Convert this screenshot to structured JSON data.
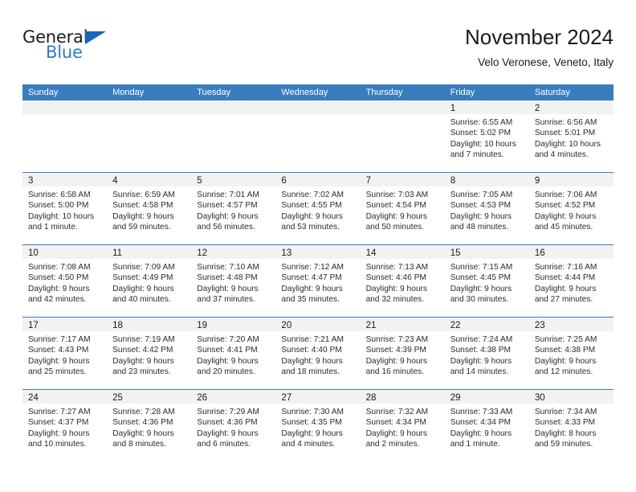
{
  "brand": {
    "name_part1": "General",
    "name_part2": "Blue",
    "flag_icon": "triangle-flag-icon",
    "accent_color": "#1268b3"
  },
  "header": {
    "title": "November 2024",
    "subtitle": "Velo Veronese, Veneto, Italy"
  },
  "calendar": {
    "header_color": "#3a7dbf",
    "band_color": "#f2f2f2",
    "weekdays": [
      "Sunday",
      "Monday",
      "Tuesday",
      "Wednesday",
      "Thursday",
      "Friday",
      "Saturday"
    ],
    "weeks": [
      [
        {
          "day": "",
          "empty": true
        },
        {
          "day": "",
          "empty": true
        },
        {
          "day": "",
          "empty": true
        },
        {
          "day": "",
          "empty": true
        },
        {
          "day": "",
          "empty": true
        },
        {
          "day": "1",
          "sunrise": "Sunrise: 6:55 AM",
          "sunset": "Sunset: 5:02 PM",
          "daylight1": "Daylight: 10 hours",
          "daylight2": "and 7 minutes."
        },
        {
          "day": "2",
          "sunrise": "Sunrise: 6:56 AM",
          "sunset": "Sunset: 5:01 PM",
          "daylight1": "Daylight: 10 hours",
          "daylight2": "and 4 minutes."
        }
      ],
      [
        {
          "day": "3",
          "sunrise": "Sunrise: 6:58 AM",
          "sunset": "Sunset: 5:00 PM",
          "daylight1": "Daylight: 10 hours",
          "daylight2": "and 1 minute."
        },
        {
          "day": "4",
          "sunrise": "Sunrise: 6:59 AM",
          "sunset": "Sunset: 4:58 PM",
          "daylight1": "Daylight: 9 hours",
          "daylight2": "and 59 minutes."
        },
        {
          "day": "5",
          "sunrise": "Sunrise: 7:01 AM",
          "sunset": "Sunset: 4:57 PM",
          "daylight1": "Daylight: 9 hours",
          "daylight2": "and 56 minutes."
        },
        {
          "day": "6",
          "sunrise": "Sunrise: 7:02 AM",
          "sunset": "Sunset: 4:55 PM",
          "daylight1": "Daylight: 9 hours",
          "daylight2": "and 53 minutes."
        },
        {
          "day": "7",
          "sunrise": "Sunrise: 7:03 AM",
          "sunset": "Sunset: 4:54 PM",
          "daylight1": "Daylight: 9 hours",
          "daylight2": "and 50 minutes."
        },
        {
          "day": "8",
          "sunrise": "Sunrise: 7:05 AM",
          "sunset": "Sunset: 4:53 PM",
          "daylight1": "Daylight: 9 hours",
          "daylight2": "and 48 minutes."
        },
        {
          "day": "9",
          "sunrise": "Sunrise: 7:06 AM",
          "sunset": "Sunset: 4:52 PM",
          "daylight1": "Daylight: 9 hours",
          "daylight2": "and 45 minutes."
        }
      ],
      [
        {
          "day": "10",
          "sunrise": "Sunrise: 7:08 AM",
          "sunset": "Sunset: 4:50 PM",
          "daylight1": "Daylight: 9 hours",
          "daylight2": "and 42 minutes."
        },
        {
          "day": "11",
          "sunrise": "Sunrise: 7:09 AM",
          "sunset": "Sunset: 4:49 PM",
          "daylight1": "Daylight: 9 hours",
          "daylight2": "and 40 minutes."
        },
        {
          "day": "12",
          "sunrise": "Sunrise: 7:10 AM",
          "sunset": "Sunset: 4:48 PM",
          "daylight1": "Daylight: 9 hours",
          "daylight2": "and 37 minutes."
        },
        {
          "day": "13",
          "sunrise": "Sunrise: 7:12 AM",
          "sunset": "Sunset: 4:47 PM",
          "daylight1": "Daylight: 9 hours",
          "daylight2": "and 35 minutes."
        },
        {
          "day": "14",
          "sunrise": "Sunrise: 7:13 AM",
          "sunset": "Sunset: 4:46 PM",
          "daylight1": "Daylight: 9 hours",
          "daylight2": "and 32 minutes."
        },
        {
          "day": "15",
          "sunrise": "Sunrise: 7:15 AM",
          "sunset": "Sunset: 4:45 PM",
          "daylight1": "Daylight: 9 hours",
          "daylight2": "and 30 minutes."
        },
        {
          "day": "16",
          "sunrise": "Sunrise: 7:16 AM",
          "sunset": "Sunset: 4:44 PM",
          "daylight1": "Daylight: 9 hours",
          "daylight2": "and 27 minutes."
        }
      ],
      [
        {
          "day": "17",
          "sunrise": "Sunrise: 7:17 AM",
          "sunset": "Sunset: 4:43 PM",
          "daylight1": "Daylight: 9 hours",
          "daylight2": "and 25 minutes."
        },
        {
          "day": "18",
          "sunrise": "Sunrise: 7:19 AM",
          "sunset": "Sunset: 4:42 PM",
          "daylight1": "Daylight: 9 hours",
          "daylight2": "and 23 minutes."
        },
        {
          "day": "19",
          "sunrise": "Sunrise: 7:20 AM",
          "sunset": "Sunset: 4:41 PM",
          "daylight1": "Daylight: 9 hours",
          "daylight2": "and 20 minutes."
        },
        {
          "day": "20",
          "sunrise": "Sunrise: 7:21 AM",
          "sunset": "Sunset: 4:40 PM",
          "daylight1": "Daylight: 9 hours",
          "daylight2": "and 18 minutes."
        },
        {
          "day": "21",
          "sunrise": "Sunrise: 7:23 AM",
          "sunset": "Sunset: 4:39 PM",
          "daylight1": "Daylight: 9 hours",
          "daylight2": "and 16 minutes."
        },
        {
          "day": "22",
          "sunrise": "Sunrise: 7:24 AM",
          "sunset": "Sunset: 4:38 PM",
          "daylight1": "Daylight: 9 hours",
          "daylight2": "and 14 minutes."
        },
        {
          "day": "23",
          "sunrise": "Sunrise: 7:25 AM",
          "sunset": "Sunset: 4:38 PM",
          "daylight1": "Daylight: 9 hours",
          "daylight2": "and 12 minutes."
        }
      ],
      [
        {
          "day": "24",
          "sunrise": "Sunrise: 7:27 AM",
          "sunset": "Sunset: 4:37 PM",
          "daylight1": "Daylight: 9 hours",
          "daylight2": "and 10 minutes."
        },
        {
          "day": "25",
          "sunrise": "Sunrise: 7:28 AM",
          "sunset": "Sunset: 4:36 PM",
          "daylight1": "Daylight: 9 hours",
          "daylight2": "and 8 minutes."
        },
        {
          "day": "26",
          "sunrise": "Sunrise: 7:29 AM",
          "sunset": "Sunset: 4:36 PM",
          "daylight1": "Daylight: 9 hours",
          "daylight2": "and 6 minutes."
        },
        {
          "day": "27",
          "sunrise": "Sunrise: 7:30 AM",
          "sunset": "Sunset: 4:35 PM",
          "daylight1": "Daylight: 9 hours",
          "daylight2": "and 4 minutes."
        },
        {
          "day": "28",
          "sunrise": "Sunrise: 7:32 AM",
          "sunset": "Sunset: 4:34 PM",
          "daylight1": "Daylight: 9 hours",
          "daylight2": "and 2 minutes."
        },
        {
          "day": "29",
          "sunrise": "Sunrise: 7:33 AM",
          "sunset": "Sunset: 4:34 PM",
          "daylight1": "Daylight: 9 hours",
          "daylight2": "and 1 minute."
        },
        {
          "day": "30",
          "sunrise": "Sunrise: 7:34 AM",
          "sunset": "Sunset: 4:33 PM",
          "daylight1": "Daylight: 8 hours",
          "daylight2": "and 59 minutes."
        }
      ]
    ]
  }
}
